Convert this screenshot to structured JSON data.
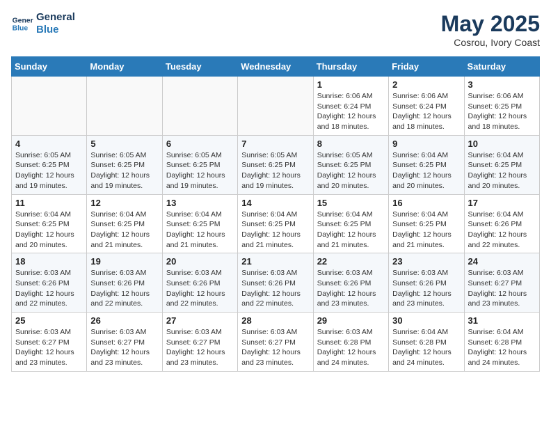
{
  "header": {
    "logo_line1": "General",
    "logo_line2": "Blue",
    "month": "May 2025",
    "location": "Cosrou, Ivory Coast"
  },
  "days_of_week": [
    "Sunday",
    "Monday",
    "Tuesday",
    "Wednesday",
    "Thursday",
    "Friday",
    "Saturday"
  ],
  "weeks": [
    [
      {
        "day": "",
        "info": ""
      },
      {
        "day": "",
        "info": ""
      },
      {
        "day": "",
        "info": ""
      },
      {
        "day": "",
        "info": ""
      },
      {
        "day": "1",
        "info": "Sunrise: 6:06 AM\nSunset: 6:24 PM\nDaylight: 12 hours\nand 18 minutes."
      },
      {
        "day": "2",
        "info": "Sunrise: 6:06 AM\nSunset: 6:24 PM\nDaylight: 12 hours\nand 18 minutes."
      },
      {
        "day": "3",
        "info": "Sunrise: 6:06 AM\nSunset: 6:25 PM\nDaylight: 12 hours\nand 18 minutes."
      }
    ],
    [
      {
        "day": "4",
        "info": "Sunrise: 6:05 AM\nSunset: 6:25 PM\nDaylight: 12 hours\nand 19 minutes."
      },
      {
        "day": "5",
        "info": "Sunrise: 6:05 AM\nSunset: 6:25 PM\nDaylight: 12 hours\nand 19 minutes."
      },
      {
        "day": "6",
        "info": "Sunrise: 6:05 AM\nSunset: 6:25 PM\nDaylight: 12 hours\nand 19 minutes."
      },
      {
        "day": "7",
        "info": "Sunrise: 6:05 AM\nSunset: 6:25 PM\nDaylight: 12 hours\nand 19 minutes."
      },
      {
        "day": "8",
        "info": "Sunrise: 6:05 AM\nSunset: 6:25 PM\nDaylight: 12 hours\nand 20 minutes."
      },
      {
        "day": "9",
        "info": "Sunrise: 6:04 AM\nSunset: 6:25 PM\nDaylight: 12 hours\nand 20 minutes."
      },
      {
        "day": "10",
        "info": "Sunrise: 6:04 AM\nSunset: 6:25 PM\nDaylight: 12 hours\nand 20 minutes."
      }
    ],
    [
      {
        "day": "11",
        "info": "Sunrise: 6:04 AM\nSunset: 6:25 PM\nDaylight: 12 hours\nand 20 minutes."
      },
      {
        "day": "12",
        "info": "Sunrise: 6:04 AM\nSunset: 6:25 PM\nDaylight: 12 hours\nand 21 minutes."
      },
      {
        "day": "13",
        "info": "Sunrise: 6:04 AM\nSunset: 6:25 PM\nDaylight: 12 hours\nand 21 minutes."
      },
      {
        "day": "14",
        "info": "Sunrise: 6:04 AM\nSunset: 6:25 PM\nDaylight: 12 hours\nand 21 minutes."
      },
      {
        "day": "15",
        "info": "Sunrise: 6:04 AM\nSunset: 6:25 PM\nDaylight: 12 hours\nand 21 minutes."
      },
      {
        "day": "16",
        "info": "Sunrise: 6:04 AM\nSunset: 6:25 PM\nDaylight: 12 hours\nand 21 minutes."
      },
      {
        "day": "17",
        "info": "Sunrise: 6:04 AM\nSunset: 6:26 PM\nDaylight: 12 hours\nand 22 minutes."
      }
    ],
    [
      {
        "day": "18",
        "info": "Sunrise: 6:03 AM\nSunset: 6:26 PM\nDaylight: 12 hours\nand 22 minutes."
      },
      {
        "day": "19",
        "info": "Sunrise: 6:03 AM\nSunset: 6:26 PM\nDaylight: 12 hours\nand 22 minutes."
      },
      {
        "day": "20",
        "info": "Sunrise: 6:03 AM\nSunset: 6:26 PM\nDaylight: 12 hours\nand 22 minutes."
      },
      {
        "day": "21",
        "info": "Sunrise: 6:03 AM\nSunset: 6:26 PM\nDaylight: 12 hours\nand 22 minutes."
      },
      {
        "day": "22",
        "info": "Sunrise: 6:03 AM\nSunset: 6:26 PM\nDaylight: 12 hours\nand 23 minutes."
      },
      {
        "day": "23",
        "info": "Sunrise: 6:03 AM\nSunset: 6:26 PM\nDaylight: 12 hours\nand 23 minutes."
      },
      {
        "day": "24",
        "info": "Sunrise: 6:03 AM\nSunset: 6:27 PM\nDaylight: 12 hours\nand 23 minutes."
      }
    ],
    [
      {
        "day": "25",
        "info": "Sunrise: 6:03 AM\nSunset: 6:27 PM\nDaylight: 12 hours\nand 23 minutes."
      },
      {
        "day": "26",
        "info": "Sunrise: 6:03 AM\nSunset: 6:27 PM\nDaylight: 12 hours\nand 23 minutes."
      },
      {
        "day": "27",
        "info": "Sunrise: 6:03 AM\nSunset: 6:27 PM\nDaylight: 12 hours\nand 23 minutes."
      },
      {
        "day": "28",
        "info": "Sunrise: 6:03 AM\nSunset: 6:27 PM\nDaylight: 12 hours\nand 23 minutes."
      },
      {
        "day": "29",
        "info": "Sunrise: 6:03 AM\nSunset: 6:28 PM\nDaylight: 12 hours\nand 24 minutes."
      },
      {
        "day": "30",
        "info": "Sunrise: 6:04 AM\nSunset: 6:28 PM\nDaylight: 12 hours\nand 24 minutes."
      },
      {
        "day": "31",
        "info": "Sunrise: 6:04 AM\nSunset: 6:28 PM\nDaylight: 12 hours\nand 24 minutes."
      }
    ]
  ]
}
